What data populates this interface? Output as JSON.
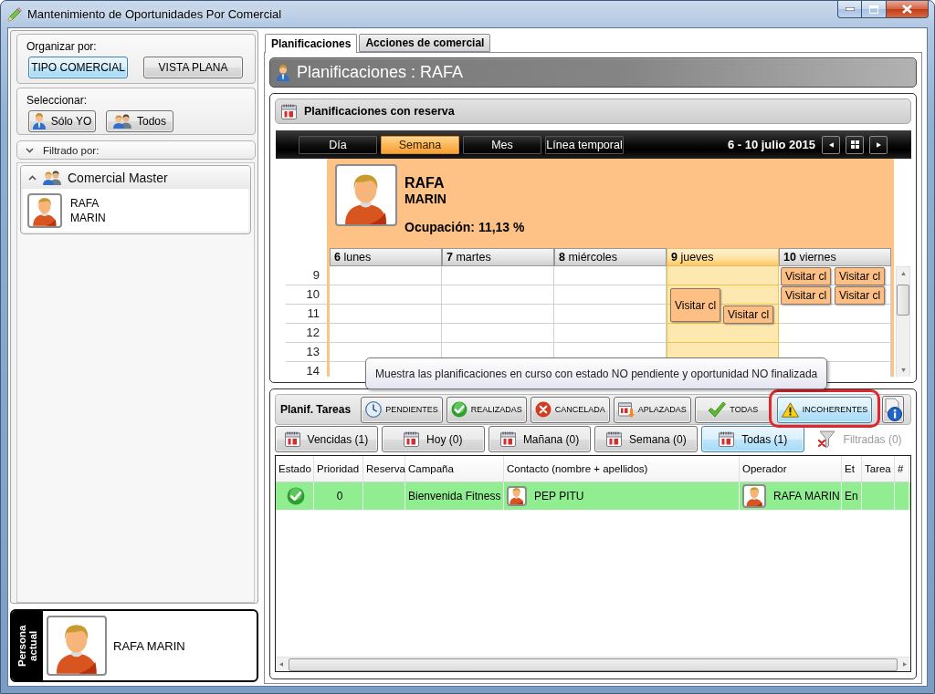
{
  "window": {
    "title": "Mantenimiento de Oportunidades Por Comercial"
  },
  "left_panel": {
    "organize": {
      "label": "Organizar por:",
      "options": [
        {
          "label": "TIPO COMERCIAL",
          "selected": true
        },
        {
          "label": "VISTA PLANA",
          "selected": false
        }
      ]
    },
    "select": {
      "label": "Seleccionar:",
      "buttons": [
        {
          "label": "Sólo YO",
          "kind": "person"
        },
        {
          "label": "Todos",
          "kind": "group"
        }
      ]
    },
    "filter": {
      "label": "Filtrado por:",
      "expanded": false
    },
    "tree": [
      {
        "label": "Comercial Master",
        "expanded": true,
        "children": [
          {
            "first_name": "RAFA",
            "last_name": "MARIN"
          }
        ]
      }
    ],
    "current_person": {
      "label": "Persona actual",
      "name": "RAFA MARIN"
    }
  },
  "tabs": [
    {
      "label": "Planificaciones",
      "selected": true
    },
    {
      "label": "Acciones de comercial",
      "selected": false
    }
  ],
  "header": {
    "title": "Planificaciones : RAFA"
  },
  "calendar": {
    "title": "Planificaciones con reserva",
    "views": [
      {
        "label": "Día",
        "selected": false
      },
      {
        "label": "Semana",
        "selected": true
      },
      {
        "label": "Mes",
        "selected": false
      },
      {
        "label": "Línea temporal",
        "selected": false
      }
    ],
    "range": "6 - 10 julio 2015",
    "resource": {
      "first_name": "RAFA",
      "last_name": "MARIN",
      "occupancy": "Ocupación: 11,13 %"
    },
    "days": [
      {
        "number": "6",
        "name": "lunes",
        "selected": false
      },
      {
        "number": "7",
        "name": "martes",
        "selected": false
      },
      {
        "number": "8",
        "name": "miércoles",
        "selected": false
      },
      {
        "number": "9",
        "name": "jueves",
        "selected": true
      },
      {
        "number": "10",
        "name": "viernes",
        "selected": false
      }
    ],
    "rows": [
      {
        "hour": "9",
        "cells": [
          {},
          {},
          {},
          {},
          {
            "appointments": [
              {
                "label": "Visitar cl",
                "kind": "short"
              },
              {
                "label": "Visitar cl",
                "kind": "short"
              }
            ]
          }
        ]
      },
      {
        "hour": "10",
        "cells": [
          {},
          {},
          {},
          {
            "appointments": [
              {
                "label": "Visitar cl",
                "kind": "long"
              }
            ]
          },
          {
            "appointments": [
              {
                "label": "Visitar cl",
                "kind": "short"
              },
              {
                "label": "Visitar cl",
                "kind": "short"
              }
            ]
          }
        ]
      },
      {
        "hour": "11",
        "cells": [
          {},
          {},
          {},
          {
            "appointments": [
              {
                "label": "Visitar cl",
                "kind": "short"
              }
            ]
          },
          {}
        ]
      },
      {
        "hour": "12",
        "cells": [
          {},
          {},
          {},
          {},
          {}
        ]
      },
      {
        "hour": "13",
        "cells": [
          {},
          {},
          {},
          {},
          {}
        ]
      },
      {
        "hour": "14",
        "cells": [
          {},
          {},
          {},
          {},
          {}
        ]
      }
    ]
  },
  "tooltip": {
    "text": "Muestra las planificaciones en curso con estado NO pendiente y oportunidad NO finalizada"
  },
  "tasks": {
    "label": "Planif. Tareas",
    "status_filters": [
      {
        "label": "PENDIENTES",
        "kind": "clock",
        "selected": false,
        "highlighted": false
      },
      {
        "label": "REALIZADAS",
        "kind": "done",
        "selected": false,
        "highlighted": false
      },
      {
        "label": "CANCELADA",
        "kind": "cancel",
        "selected": false,
        "highlighted": false
      },
      {
        "label": "APLAZADAS",
        "kind": "postponed",
        "selected": false,
        "highlighted": false
      },
      {
        "label": "TODAS",
        "kind": "all",
        "selected": false,
        "highlighted": false
      },
      {
        "label": "INCOHERENTES",
        "kind": "warning",
        "selected": true,
        "highlighted": true
      }
    ],
    "period_filters": [
      {
        "label": "Vencidas (1)",
        "kind": "calendar",
        "selected": false,
        "disabled": false
      },
      {
        "label": "Hoy (0)",
        "kind": "calendar",
        "selected": false,
        "disabled": false
      },
      {
        "label": "Mañana (0)",
        "kind": "calendar",
        "selected": false,
        "disabled": false
      },
      {
        "label": "Semana (0)",
        "kind": "calendar",
        "selected": false,
        "disabled": false
      },
      {
        "label": "Todas (1)",
        "kind": "calendar",
        "selected": true,
        "disabled": false
      },
      {
        "label": "Filtradas (0)",
        "kind": "funnel",
        "selected": false,
        "disabled": true
      }
    ],
    "table": {
      "columns": [
        "Estado",
        "Prioridad",
        "Reserva",
        "Campaña",
        "Contacto (nombre + apellidos)",
        "Operador",
        "Et",
        "Tarea",
        "#"
      ],
      "rows": [
        {
          "kind": "done",
          "priority": "0",
          "campaign": "Bienvenida Fitness",
          "contact": "PEP PITU",
          "operator": "RAFA MARIN",
          "column_7": "En"
        }
      ]
    }
  }
}
